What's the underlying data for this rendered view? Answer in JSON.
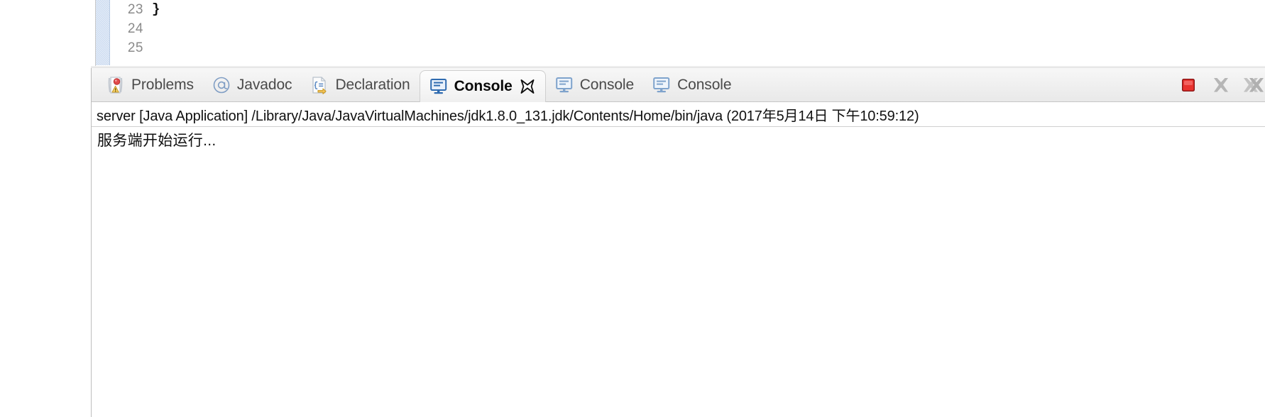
{
  "editor": {
    "line_numbers": [
      "23",
      "24",
      "25"
    ],
    "code_lines": [
      "}",
      "",
      ""
    ],
    "fold_margin_color": "#c9daf0"
  },
  "view_panel": {
    "tabs": [
      {
        "label": "Problems",
        "icon": "problems-icon",
        "active": false
      },
      {
        "label": "Javadoc",
        "icon": "javadoc-at-icon",
        "active": false
      },
      {
        "label": "Declaration",
        "icon": "declaration-icon",
        "active": false
      },
      {
        "label": "Console",
        "icon": "console-icon",
        "active": true
      },
      {
        "label": "Console",
        "icon": "console-icon",
        "active": false
      },
      {
        "label": "Console",
        "icon": "console-icon",
        "active": false
      }
    ],
    "toolbar": [
      {
        "name": "terminate-button",
        "icon": "red-stop-square-icon"
      },
      {
        "name": "remove-launch-button",
        "icon": "gray-x-icon"
      },
      {
        "name": "remove-all-launches-button",
        "icon": "gray-double-x-icon"
      }
    ],
    "close_icon": "close-x-icon"
  },
  "console": {
    "status_line": "server [Java Application] /Library/Java/JavaVirtualMachines/jdk1.8.0_131.jdk/Contents/Home/bin/java (2017年5月14日 下午10:59:12)",
    "output_lines": [
      "服务端开始运行..."
    ]
  },
  "colors": {
    "accent_blue": "#4a79b8",
    "stop_red": "#e03030",
    "warning_yellow": "#f0c040",
    "tab_bar_bg": "#efefef",
    "border": "#c6c6c6"
  }
}
